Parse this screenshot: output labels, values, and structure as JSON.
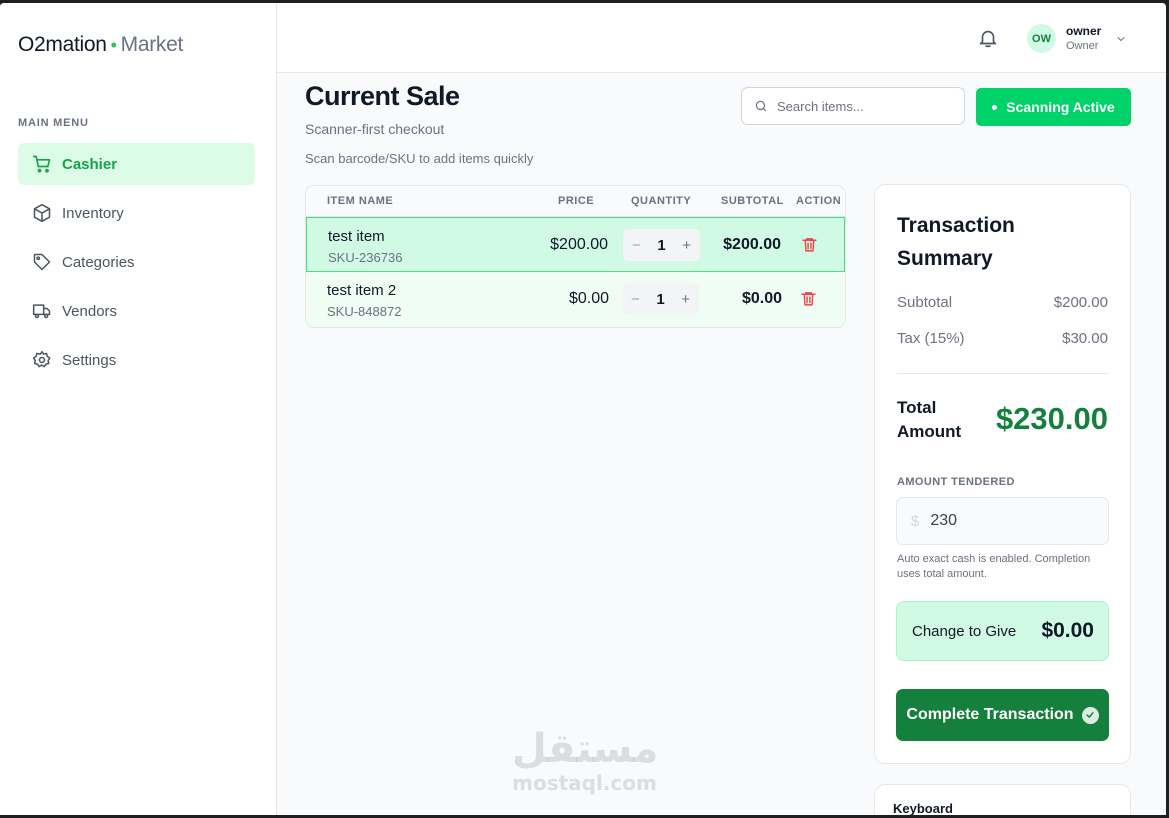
{
  "app": {
    "brand": "O2mation",
    "brand_suffix": "Market"
  },
  "sidebar": {
    "section_title": "MAIN MENU",
    "items": [
      {
        "label": "Cashier",
        "icon": "cart-icon",
        "active": true
      },
      {
        "label": "Inventory",
        "icon": "box-icon",
        "active": false
      },
      {
        "label": "Categories",
        "icon": "tag-icon",
        "active": false
      },
      {
        "label": "Vendors",
        "icon": "truck-icon",
        "active": false
      },
      {
        "label": "Settings",
        "icon": "gear-icon",
        "active": false
      }
    ]
  },
  "header": {
    "avatar_initials": "OW",
    "user_name": "owner",
    "user_role": "Owner"
  },
  "page": {
    "title": "Current Sale",
    "subtitle": "Scanner-first checkout",
    "hint": "Scan barcode/SKU to add items quickly",
    "search_placeholder": "Search items...",
    "scan_button": "Scanning Active"
  },
  "table": {
    "columns": [
      "ITEM NAME",
      "PRICE",
      "QUANTITY",
      "SUBTOTAL",
      "ACTION"
    ],
    "rows": [
      {
        "name": "test item",
        "sku": "SKU-236736",
        "price": "$200.00",
        "qty": "1",
        "subtotal": "$200.00",
        "selected": true
      },
      {
        "name": "test item 2",
        "sku": "SKU-848872",
        "price": "$0.00",
        "qty": "1",
        "subtotal": "$0.00",
        "selected": false
      }
    ],
    "minus_symbol": "−",
    "plus_symbol": "+"
  },
  "summary": {
    "title": "Transaction Summary",
    "subtotal_label": "Subtotal",
    "subtotal_value": "$200.00",
    "tax_label": "Tax (15%)",
    "tax_value": "$30.00",
    "total_label": "Total Amount",
    "total_value": "$230.00",
    "tendered_label": "AMOUNT TENDERED",
    "currency_symbol": "$",
    "tendered_value": "230",
    "note": "Auto exact cash is enabled. Completion uses total amount.",
    "change_label": "Change to Give",
    "change_value": "$0.00",
    "complete_button": "Complete Transaction"
  },
  "keyboard": {
    "title": "Keyboard"
  },
  "watermark": {
    "arabic": "مستقل",
    "latin": "mostaql.com"
  },
  "colors": {
    "accent": "#00d26a",
    "brand_green": "#15803d",
    "active_bg": "#dcfce7",
    "danger": "#ef4444"
  }
}
